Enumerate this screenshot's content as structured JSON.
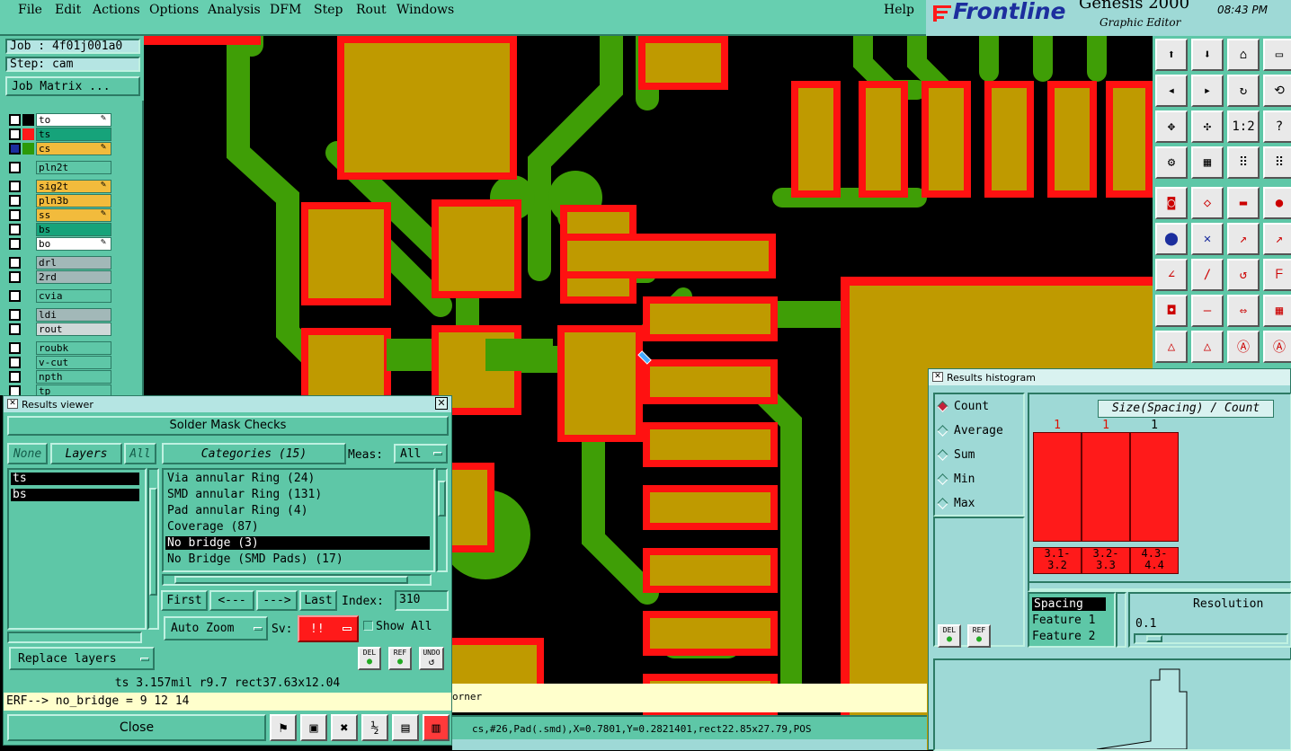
{
  "menu": [
    "File",
    "Edit",
    "Actions",
    "Options",
    "Analysis",
    "DFM",
    "Step",
    "Rout",
    "Windows"
  ],
  "help": "Help",
  "logo": {
    "brand": "Frontline",
    "product": "Genesis 2000",
    "subtitle": "Graphic Editor",
    "time": "08:43 PM"
  },
  "job": {
    "job_label": "Job : 4f01j001a0",
    "step_label": "Step: cam",
    "matrix_button": "Job Matrix ..."
  },
  "layers": [
    {
      "name": "to",
      "color": "#ffffff",
      "swatch": "#000000",
      "edit": "✎"
    },
    {
      "name": "ts",
      "color": "#16a37a",
      "swatch": "#ff1a1a",
      "edit": ""
    },
    {
      "name": "cs",
      "color": "#f2bb3c",
      "swatch": "#2c9a0a",
      "edit": "✎"
    },
    {
      "name": "pln2t",
      "color": "#5ec7a7",
      "swatch": "",
      "edit": ""
    },
    {
      "name": "sig2t",
      "color": "#f2bb3c",
      "swatch": "",
      "edit": "✎"
    },
    {
      "name": "pln3b",
      "color": "#f2bb3c",
      "swatch": "",
      "edit": ""
    },
    {
      "name": "ss",
      "color": "#f2bb3c",
      "swatch": "",
      "edit": "✎"
    },
    {
      "name": "bs",
      "color": "#16a37a",
      "swatch": "",
      "edit": ""
    },
    {
      "name": "bo",
      "color": "#ffffff",
      "swatch": "",
      "edit": "✎"
    },
    {
      "name": "drl",
      "color": "#a2b8b8",
      "swatch": "",
      "edit": ""
    },
    {
      "name": "2rd",
      "color": "#a2b8b8",
      "swatch": "",
      "edit": ""
    },
    {
      "name": "cvia",
      "color": "#5ec7a7",
      "swatch": "",
      "edit": ""
    },
    {
      "name": "ldi",
      "color": "#a2b8b8",
      "swatch": "",
      "edit": ""
    },
    {
      "name": "rout",
      "color": "#cfd8d8",
      "swatch": "",
      "edit": ""
    },
    {
      "name": "roubk",
      "color": "#5ec7a7",
      "swatch": "",
      "edit": ""
    },
    {
      "name": "v-cut",
      "color": "#5ec7a7",
      "swatch": "",
      "edit": ""
    },
    {
      "name": "npth",
      "color": "#5ec7a7",
      "swatch": "",
      "edit": ""
    },
    {
      "name": "tp",
      "color": "#5ec7a7",
      "swatch": "",
      "edit": ""
    }
  ],
  "results_viewer": {
    "title": "Results viewer",
    "header": "Solder Mask Checks",
    "none": "None",
    "layers": "Layers",
    "all": "All",
    "categories": "Categories (15)",
    "meas_label": "Meas:",
    "meas_value": "All",
    "layer_list": [
      "ts",
      "bs"
    ],
    "category_list": [
      "Via annular Ring (24)",
      "SMD annular Ring (131)",
      "Pad annular Ring (4)",
      "Coverage (87)",
      "No bridge (3)",
      "No Bridge (SMD Pads) (17)"
    ],
    "selected_category": "No bridge (3)",
    "first": "First",
    "prev": "<---",
    "next": "--->",
    "last": "Last",
    "index_label": "Index:",
    "index_value": "310",
    "auto_zoom": "Auto Zoom",
    "sv_label": "Sv:",
    "sv_value": "!!",
    "show_all": "Show All",
    "replace_layers": "Replace layers",
    "del": "DEL",
    "ref": "REF",
    "undo": "UNDO",
    "status": "ts 3.157mil  r9.7  rect37.63x12.04",
    "erf": "ERF--> no_bridge = 9 12 14",
    "close": "Close"
  },
  "histogram": {
    "title": "Results histogram",
    "modes": [
      "Count",
      "Average",
      "Sum",
      "Min",
      "Max"
    ],
    "selected_mode": "Count",
    "chart_title": "Size(Spacing) / Count",
    "bars": [
      {
        "count": "1",
        "range": "3.1-\n3.2"
      },
      {
        "count": "1",
        "range": "3.2-\n3.3"
      },
      {
        "count": "1",
        "range": "4.3-\n4.4"
      }
    ],
    "measure_list": [
      "Spacing",
      "Feature 1",
      "Feature 2"
    ],
    "resolution_label": "Resolution",
    "resolution_value": "0.1",
    "del": "DEL",
    "ref": "REF"
  },
  "canvas_status": {
    "line1": "orner",
    "line2": "cs,#26,Pad(.smd),X=0.7801,Y=0.2821401,rect22.85x27.79,POS"
  },
  "colors": {
    "copper": "#bf9a00",
    "trace": "#3f9e06",
    "mask": "#ff1111",
    "bg": "#000000",
    "ui": "#5ec7a7"
  }
}
